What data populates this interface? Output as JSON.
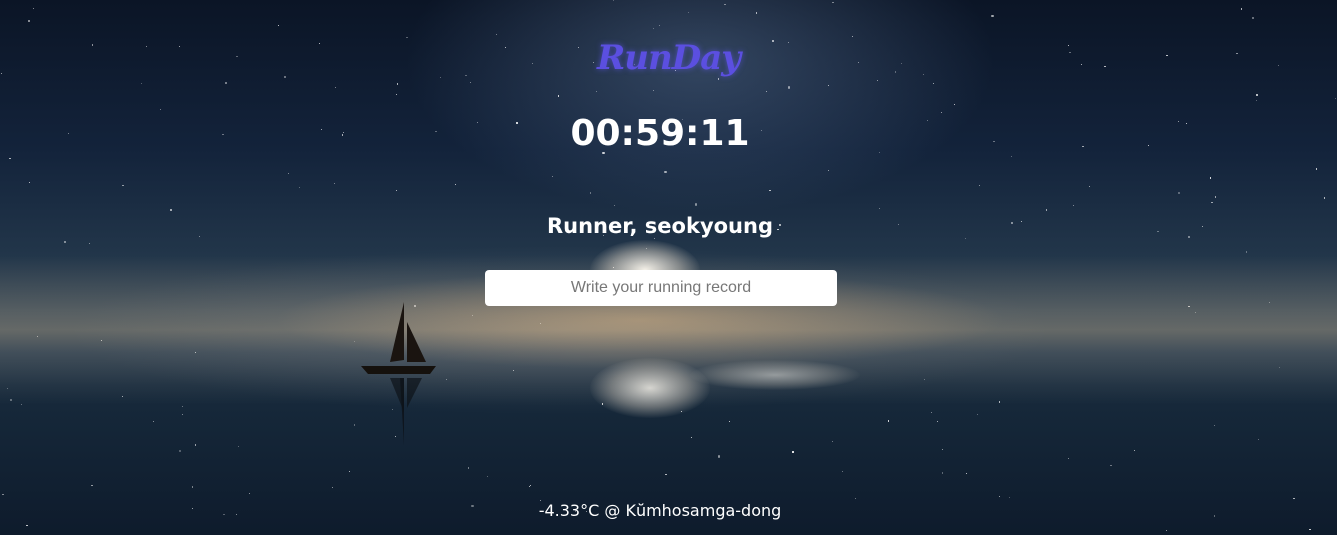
{
  "app": {
    "logo_text": "RunDay"
  },
  "clock": {
    "time": "00:59:11"
  },
  "greeting": {
    "text": "Runner, seokyoung"
  },
  "record_input": {
    "placeholder": "Write your running record",
    "value": ""
  },
  "weather": {
    "text": "-4.33°C @ Kŭmhosamga-dong"
  },
  "colors": {
    "logo": "#5b4fe0",
    "text": "#ffffff",
    "input_bg": "#ffffff"
  },
  "background": {
    "icon": "sailboat-icon"
  }
}
